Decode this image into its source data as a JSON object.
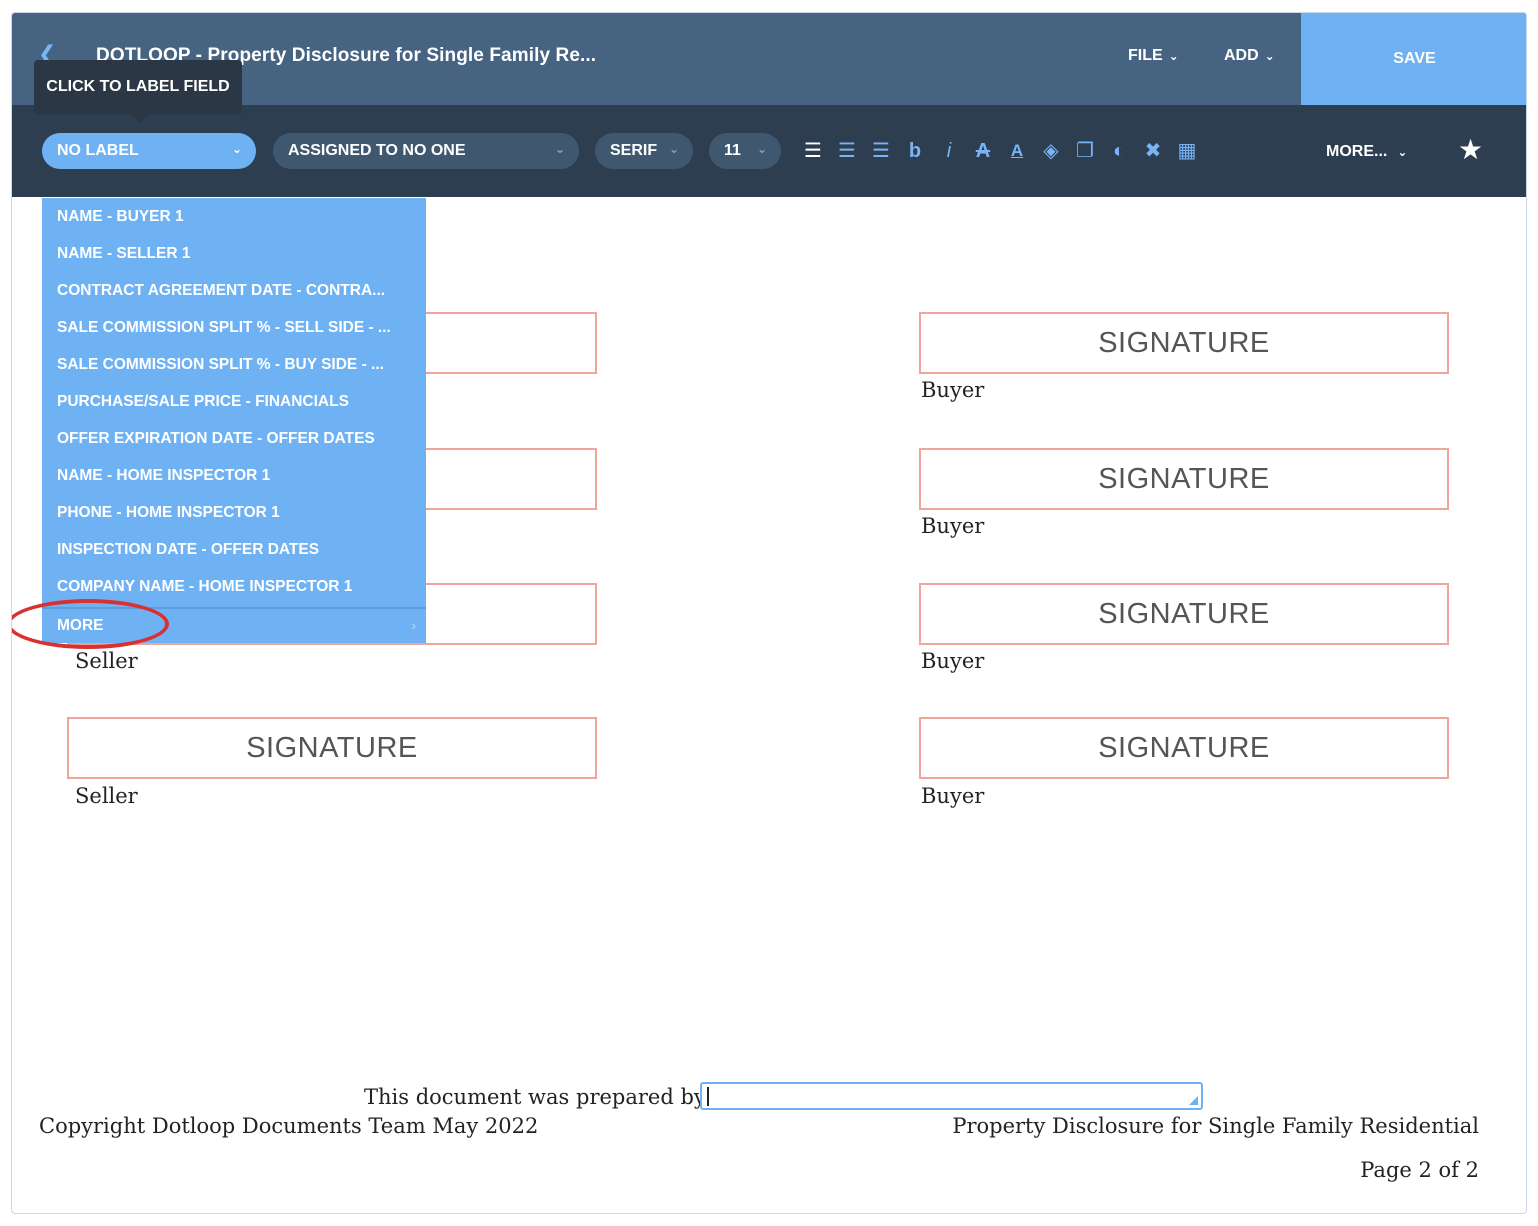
{
  "header": {
    "title": "DOTLOOP - Property Disclosure for Single Family Re...",
    "file_label": "FILE",
    "add_label": "ADD",
    "save_label": "SAVE"
  },
  "tooltip": {
    "text": "CLICK TO LABEL FIELD"
  },
  "toolbar": {
    "label_select": "NO LABEL",
    "assigned_select": "ASSIGNED TO NO ONE",
    "font_select": "SERIF",
    "size_select": "11",
    "more_label": "MORE...",
    "format_icons": [
      "align-left-icon",
      "align-center-icon",
      "align-right-icon",
      "bold-icon",
      "italic-icon",
      "strikethrough-icon",
      "text-color-icon",
      "fill-icon",
      "copy-icon",
      "contrast-icon",
      "delete-icon",
      "table-icon",
      "star-icon"
    ]
  },
  "dropdown": {
    "items": [
      "NAME - BUYER 1",
      "NAME - SELLER 1",
      "CONTRACT AGREEMENT DATE - CONTRA...",
      "SALE COMMISSION SPLIT % - SELL SIDE - ...",
      "SALE COMMISSION SPLIT % - BUY SIDE - ...",
      "PURCHASE/SALE PRICE - FINANCIALS",
      "OFFER EXPIRATION DATE - OFFER DATES",
      "NAME - HOME INSPECTOR 1",
      "PHONE - HOME INSPECTOR 1",
      "INSPECTION DATE - OFFER DATES",
      "COMPANY NAME - HOME INSPECTOR 1"
    ],
    "more_label": "MORE"
  },
  "document": {
    "signature_text": "SIGNATURE",
    "seller_label": "Seller",
    "buyer_label": "Buyer",
    "prepared_by": "This document was prepared by",
    "copyright": "Copyright Dotloop Documents Team May 2022",
    "doc_name": "Property Disclosure for Single Family Residential",
    "page_info": "Page 2 of 2"
  },
  "colors": {
    "header_bg": "#466482",
    "toolbar_bg": "#2c3e50",
    "accent": "#6fb2f4",
    "signature_border": "#f0a49a",
    "annotation_red": "#d93030"
  }
}
